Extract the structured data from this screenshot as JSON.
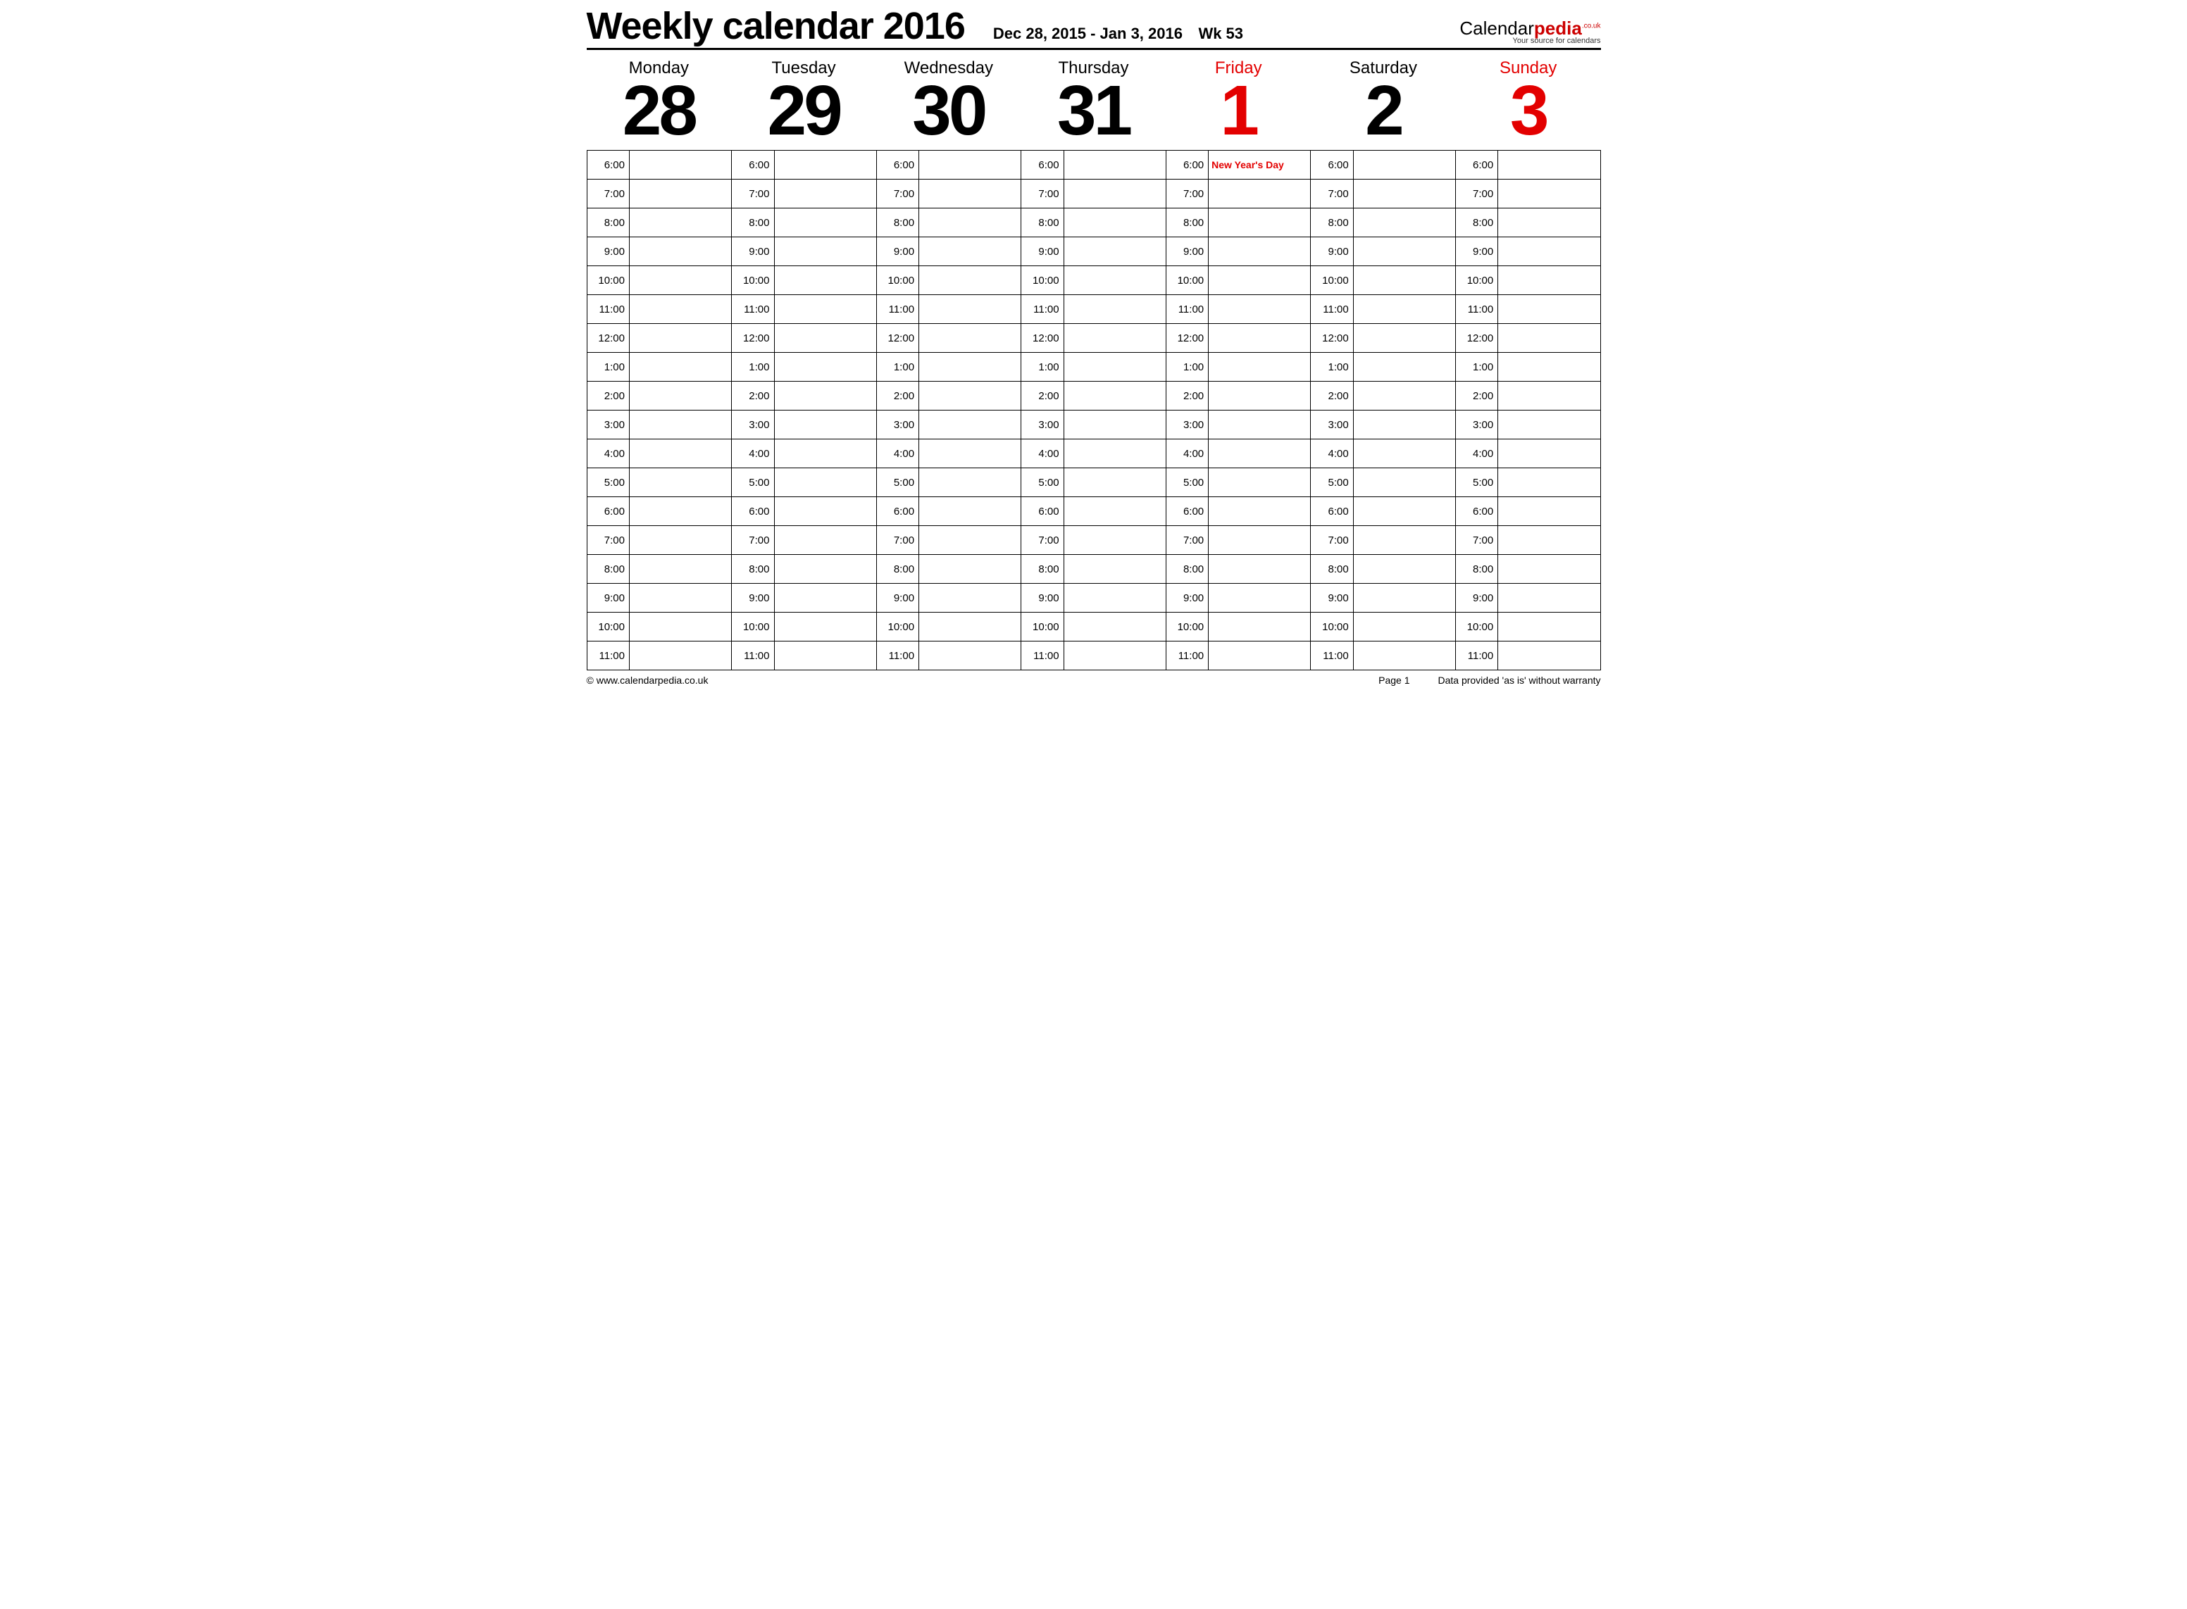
{
  "header": {
    "title": "Weekly calendar 2016",
    "date_range": "Dec 28, 2015 - Jan 3, 2016",
    "week_label": "Wk 53"
  },
  "logo": {
    "brand_left": "Calendar",
    "brand_right": "pedia",
    "domain": ".co.uk",
    "tagline": "Your source for calendars"
  },
  "days": [
    {
      "name": "Monday",
      "num": "28",
      "red": false
    },
    {
      "name": "Tuesday",
      "num": "29",
      "red": false
    },
    {
      "name": "Wednesday",
      "num": "30",
      "red": false
    },
    {
      "name": "Thursday",
      "num": "31",
      "red": false
    },
    {
      "name": "Friday",
      "num": "1",
      "red": true
    },
    {
      "name": "Saturday",
      "num": "2",
      "red": false
    },
    {
      "name": "Sunday",
      "num": "3",
      "red": true
    }
  ],
  "hours": [
    "6:00",
    "7:00",
    "8:00",
    "9:00",
    "10:00",
    "11:00",
    "12:00",
    "1:00",
    "2:00",
    "3:00",
    "4:00",
    "5:00",
    "6:00",
    "7:00",
    "8:00",
    "9:00",
    "10:00",
    "11:00"
  ],
  "events": {
    "4": {
      "0": {
        "text": "New Year's Day",
        "red": true
      }
    }
  },
  "footer": {
    "left": "© www.calendarpedia.co.uk",
    "page": "Page 1",
    "right": "Data provided 'as is' without warranty"
  }
}
